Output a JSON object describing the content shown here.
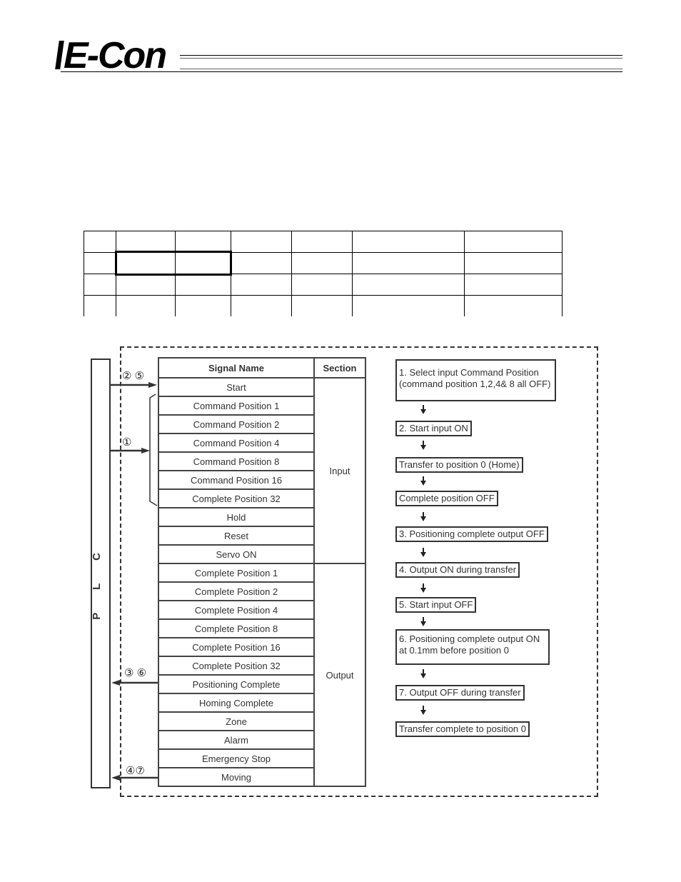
{
  "header": {
    "logo_text": "E-Con"
  },
  "empty_table": {
    "rows": 4,
    "columns": 7
  },
  "diagram": {
    "plc_label": "P L C",
    "table": {
      "headers": [
        "Signal Name",
        "Section"
      ],
      "input_section": "Input",
      "output_section": "Output",
      "input_signals": [
        "Start",
        "Command Position 1",
        "Command Position 2",
        "Command Position 4",
        "Command Position 8",
        "Command Position 16",
        "Complete Position 32",
        "Hold",
        "Reset",
        "Servo ON"
      ],
      "output_signals": [
        "Complete Position 1",
        "Complete Position 2",
        "Complete Position 4",
        "Complete Position 8",
        "Complete Position 16",
        "Complete Position 32",
        "Positioning Complete",
        "Homing Complete",
        "Zone",
        "Alarm",
        "Emergency Stop",
        "Moving"
      ]
    },
    "markers": {
      "start": "② ⑤",
      "command": "①",
      "positioning": "③ ⑥",
      "moving": "④⑦"
    },
    "flow": [
      "1. Select input Command Position\n(command position 1,2,4& 8 all OFF)",
      "2. Start input ON",
      "Transfer to position 0 (Home)",
      "Complete position OFF",
      "3. Positioning complete output OFF",
      "4. Output ON during transfer",
      "5. Start input OFF",
      "6. Positioning complete output ON\nat 0.1mm before position 0",
      "7. Output OFF during transfer",
      "Transfer complete to position 0"
    ]
  }
}
